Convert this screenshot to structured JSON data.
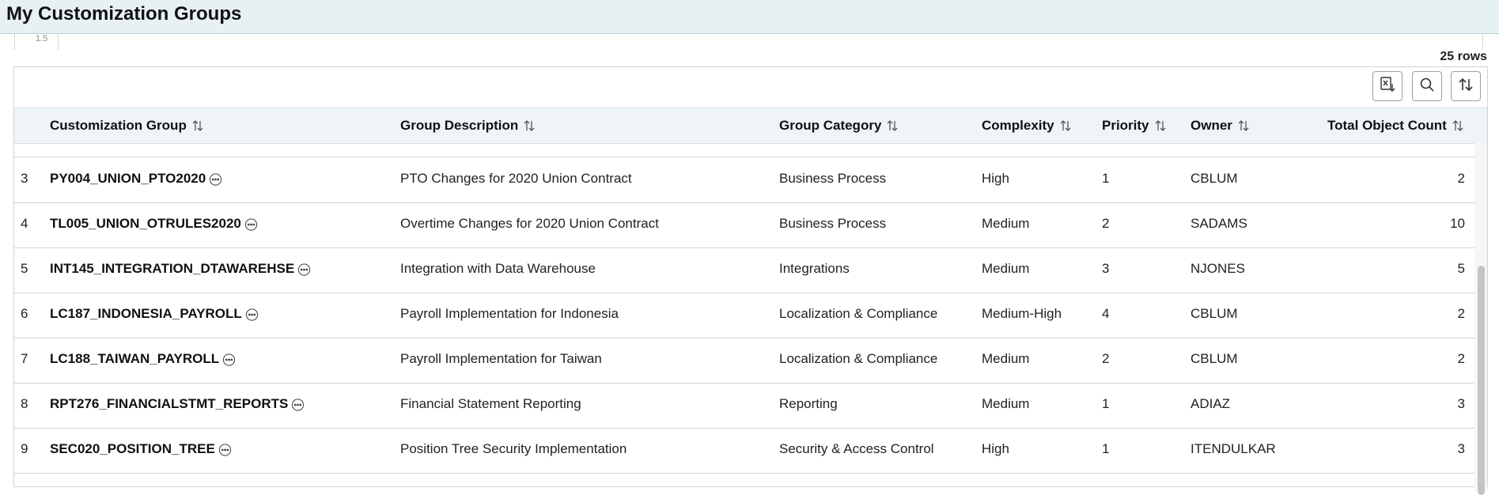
{
  "page": {
    "title": "My Customization Groups"
  },
  "behind_chart": {
    "tick_label": "1.5"
  },
  "grid": {
    "row_count_label": "25 rows",
    "toolbar": {
      "export_icon": "export-excel-icon",
      "search_icon": "search-icon",
      "sort_icon": "sort-icon"
    },
    "columns": [
      "Customization Group",
      "Group Description",
      "Group Category",
      "Complexity",
      "Priority",
      "Owner",
      "Total Object Count"
    ],
    "rows": [
      {
        "idx": "3",
        "name": "PY004_UNION_PTO2020",
        "desc": "PTO Changes for 2020 Union Contract",
        "cat": "Business Process",
        "cx": "High",
        "pri": "1",
        "own": "CBLUM",
        "cnt": "2"
      },
      {
        "idx": "4",
        "name": "TL005_UNION_OTRULES2020",
        "desc": "Overtime Changes for 2020 Union Contract",
        "cat": "Business Process",
        "cx": "Medium",
        "pri": "2",
        "own": "SADAMS",
        "cnt": "10"
      },
      {
        "idx": "5",
        "name": "INT145_INTEGRATION_DTAWAREHSE",
        "desc": "Integration with Data Warehouse",
        "cat": "Integrations",
        "cx": "Medium",
        "pri": "3",
        "own": "NJONES",
        "cnt": "5"
      },
      {
        "idx": "6",
        "name": "LC187_INDONESIA_PAYROLL",
        "desc": "Payroll Implementation for Indonesia",
        "cat": "Localization & Compliance",
        "cx": "Medium-High",
        "pri": "4",
        "own": "CBLUM",
        "cnt": "2"
      },
      {
        "idx": "7",
        "name": "LC188_TAIWAN_PAYROLL",
        "desc": "Payroll Implementation for Taiwan",
        "cat": "Localization & Compliance",
        "cx": "Medium",
        "pri": "2",
        "own": "CBLUM",
        "cnt": "2"
      },
      {
        "idx": "8",
        "name": "RPT276_FINANCIALSTMT_REPORTS",
        "desc": "Financial Statement Reporting",
        "cat": "Reporting",
        "cx": "Medium",
        "pri": "1",
        "own": "ADIAZ",
        "cnt": "3"
      },
      {
        "idx": "9",
        "name": "SEC020_POSITION_TREE",
        "desc": "Position Tree Security Implementation",
        "cat": "Security & Access Control",
        "cx": "High",
        "pri": "1",
        "own": "ITENDULKAR",
        "cnt": "3"
      }
    ]
  }
}
